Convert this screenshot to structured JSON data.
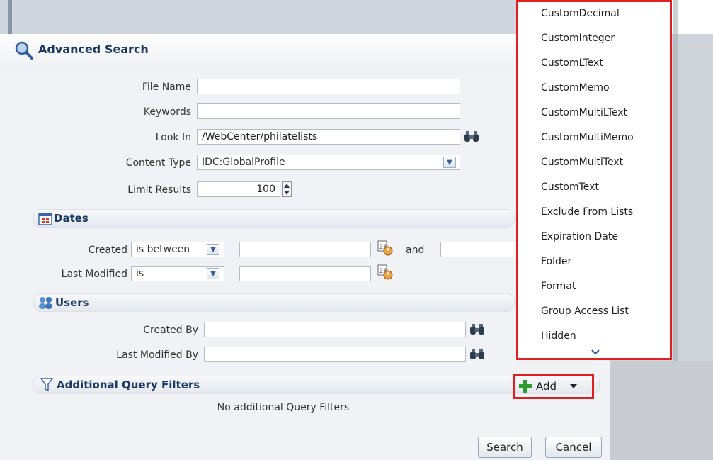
{
  "title": "Advanced Search",
  "form": {
    "file_name": {
      "label": "File Name",
      "value": ""
    },
    "keywords": {
      "label": "Keywords",
      "value": ""
    },
    "look_in": {
      "label": "Look In",
      "value": "/WebCenter/philatelists"
    },
    "content_type": {
      "label": "Content Type",
      "value": "IDC:GlobalProfile"
    },
    "limit_results": {
      "label": "Limit Results",
      "value": "100"
    }
  },
  "dates": {
    "title": "Dates",
    "created": {
      "label": "Created",
      "operator": "is between",
      "and_label": "and"
    },
    "last_modified": {
      "label": "Last Modified",
      "operator": "is"
    }
  },
  "users": {
    "title": "Users",
    "created_by": {
      "label": "Created By",
      "value": ""
    },
    "last_modified_by": {
      "label": "Last Modified By",
      "value": ""
    }
  },
  "filters": {
    "title": "Additional Query Filters",
    "add_label": "Add",
    "empty_text": "No additional Query Filters"
  },
  "buttons": {
    "search": "Search",
    "cancel": "Cancel"
  },
  "menu": {
    "items": [
      "CustomDecimal",
      "CustomInteger",
      "CustomLText",
      "CustomMemo",
      "CustomMultiLText",
      "CustomMultiMemo",
      "CustomMultiText",
      "CustomText",
      "Exclude From Lists",
      "Expiration Date",
      "Folder",
      "Format",
      "Group Access List",
      "Hidden"
    ]
  },
  "colors": {
    "highlight": "#e02020",
    "title": "#1b3a63"
  }
}
